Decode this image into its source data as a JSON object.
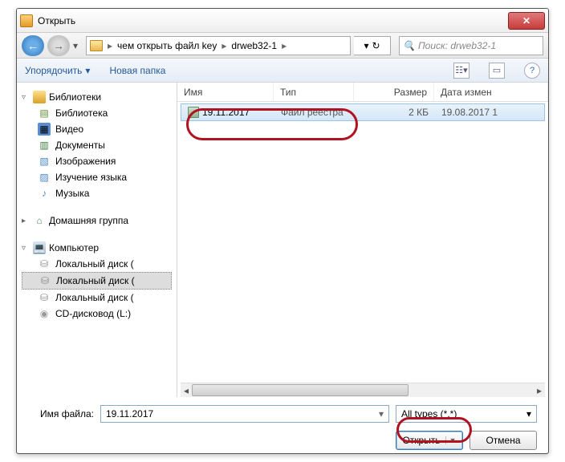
{
  "window": {
    "title": "Открыть"
  },
  "nav": {
    "breadcrumb": [
      "чем открыть файл key",
      "drweb32-1"
    ],
    "search_placeholder": "Поиск: drweb32-1"
  },
  "toolbar": {
    "organize": "Упорядочить",
    "new_folder": "Новая папка"
  },
  "sidebar": {
    "libraries": {
      "root": "Библиотеки",
      "items": [
        "Библиотека",
        "Видео",
        "Документы",
        "Изображения",
        "Изучение языка",
        "Музыка"
      ]
    },
    "homegroup": {
      "root": "Домашняя группа"
    },
    "computer": {
      "root": "Компьютер",
      "items": [
        "Локальный диск (",
        "Локальный диск (",
        "Локальный диск (",
        "CD-дисковод (L:)"
      ]
    }
  },
  "columns": {
    "name": "Имя",
    "type": "Тип",
    "size": "Размер",
    "date": "Дата измен"
  },
  "files": [
    {
      "name": "19.11.2017",
      "type": "Файл реестра",
      "size": "2 КБ",
      "date": "19.08.2017 1"
    }
  ],
  "bottom": {
    "filename_label": "Имя файла:",
    "filename_value": "19.11.2017",
    "filetype": "All types (*.*)",
    "open": "Открыть",
    "cancel": "Отмена"
  }
}
